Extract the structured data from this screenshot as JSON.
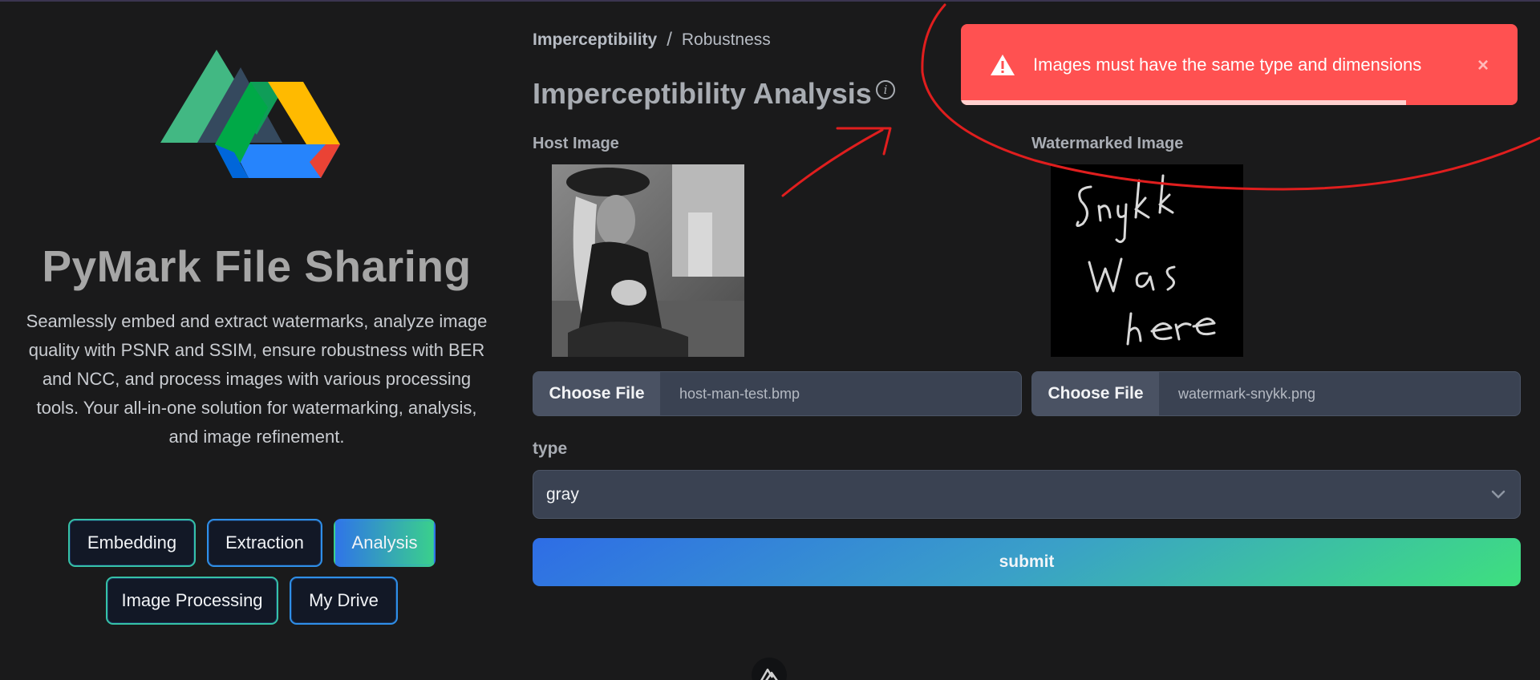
{
  "app": {
    "title": "PyMark File Sharing",
    "description": "Seamlessly embed and extract watermarks, analyze image quality with PSNR and SSIM, ensure robustness with BER and NCC, and process images with various processing tools. Your all-in-one solution for watermarking, analysis, and image refinement."
  },
  "nav": {
    "embedding": "Embedding",
    "extraction": "Extraction",
    "analysis": "Analysis",
    "image_processing": "Image Processing",
    "my_drive": "My Drive",
    "active": "Analysis"
  },
  "breadcrumb": {
    "current": "Imperceptibility",
    "separator": "/",
    "other": "Robustness"
  },
  "page": {
    "title": "Imperceptibility Analysis",
    "info_icon": "info-icon"
  },
  "host": {
    "label": "Host Image",
    "choose_label": "Choose File",
    "file_name": "host-man-test.bmp"
  },
  "watermarked": {
    "label": "Watermarked Image",
    "choose_label": "Choose File",
    "file_name": "watermark-snykk.png",
    "handwriting": "Snykk Was here"
  },
  "form": {
    "type_label": "type",
    "type_value": "gray",
    "submit_label": "submit"
  },
  "toast": {
    "message": "Images must have the same type and dimensions",
    "close": "×",
    "icon": "warning-triangle-icon",
    "progress": 0.8,
    "color": "#ff5151"
  },
  "colors": {
    "background": "#1a1a1b",
    "accent_blue": "#2f74e8",
    "accent_green": "#3ad08c",
    "annotation": "#e01e1e"
  }
}
